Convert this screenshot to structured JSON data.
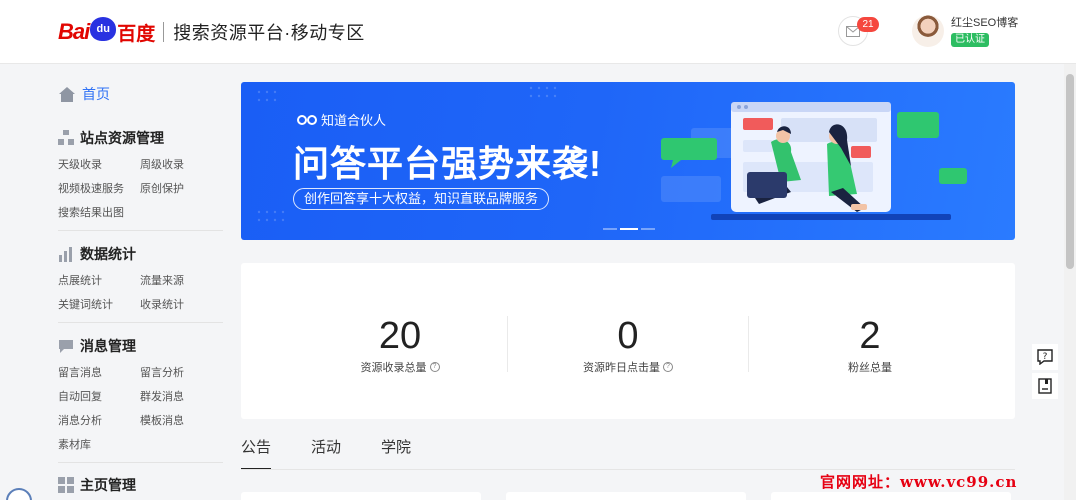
{
  "header": {
    "logo": {
      "bai": "Bai",
      "du": "du",
      "cn": "百度"
    },
    "platform": "搜索资源平台·移动专区",
    "message_count": "21",
    "user_name": "红尘SEO博客",
    "verified_label": "已认证"
  },
  "sidebar": {
    "home": "首页",
    "sections": [
      {
        "title": "站点资源管理",
        "icon": "sitemap-icon",
        "items": [
          "天级收录",
          "周级收录",
          "视频极速服务",
          "原创保护",
          "搜索结果出图"
        ]
      },
      {
        "title": "数据统计",
        "icon": "bar-chart-icon",
        "items": [
          "点展统计",
          "流量来源",
          "关键词统计",
          "收录统计"
        ]
      },
      {
        "title": "消息管理",
        "icon": "message-icon",
        "items": [
          "留言消息",
          "留言分析",
          "自动回复",
          "群发消息",
          "消息分析",
          "模板消息",
          "素材库"
        ]
      },
      {
        "title": "主页管理",
        "icon": "grid-icon",
        "items": []
      }
    ]
  },
  "banner": {
    "brand": "知道合伙人",
    "headline": "问答平台强势来袭!",
    "subtitle": "创作回答享十大权益，知识直联品牌服务"
  },
  "stats": [
    {
      "value": "20",
      "label": "资源收录总量",
      "help": true
    },
    {
      "value": "0",
      "label": "资源昨日点击量",
      "help": true
    },
    {
      "value": "2",
      "label": "粉丝总量",
      "help": false
    }
  ],
  "tabs": [
    "公告",
    "活动",
    "学院"
  ],
  "active_tab": "公告",
  "watermark": "官网网址：www.vc99.cn",
  "colors": {
    "accent": "#3072f6",
    "badge": "#f5473e",
    "verified": "#2dbd62",
    "banner": "#1a5ef5"
  }
}
